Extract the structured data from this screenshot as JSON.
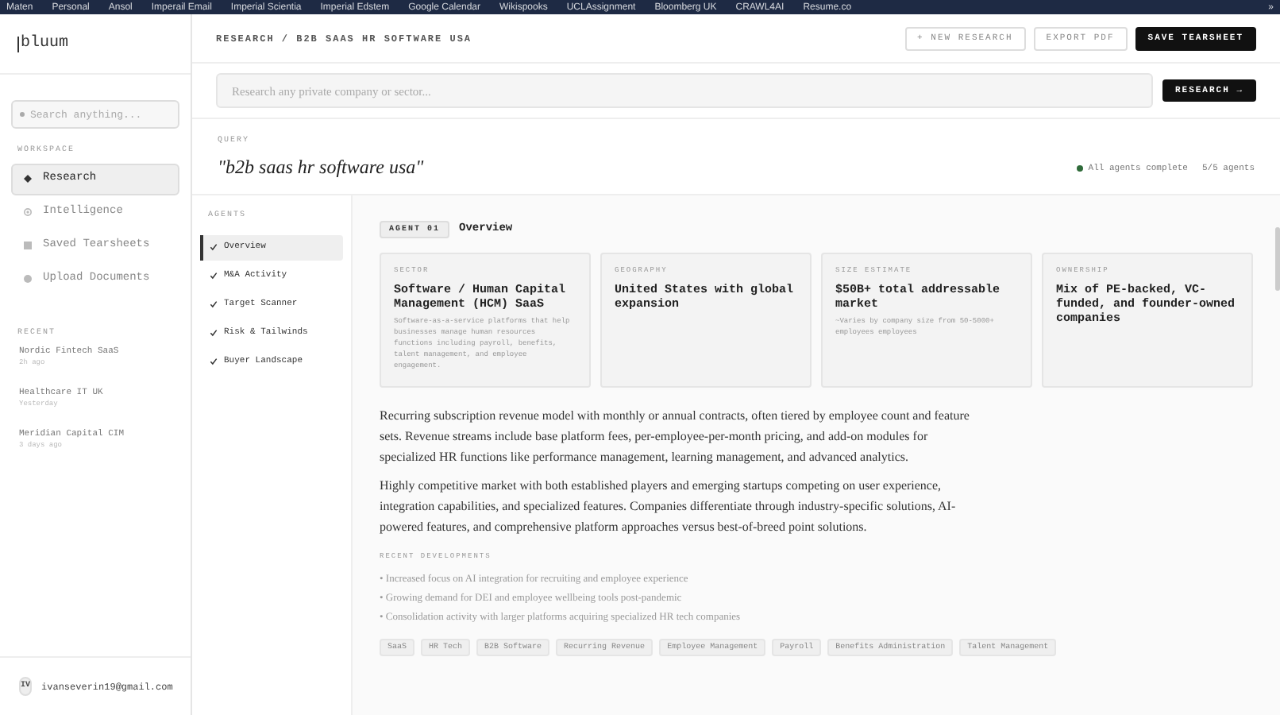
{
  "bookmarks_bar": {
    "items": [
      "Maten",
      "Personal",
      "Ansol",
      "Imperail Email",
      "Imperial Scientia",
      "Imperial Edstem",
      "Google Calendar",
      "Wikispooks",
      "UCLAssignment",
      "Bloomberg UK",
      "CRAWL4AI",
      "Resume.co"
    ],
    "overflow": "»"
  },
  "sidebar": {
    "logo": "bluum",
    "search": {
      "placeholder": "Search anything..."
    },
    "workspace_label": "WORKSPACE",
    "nav": [
      {
        "label": "Research",
        "selected": true
      },
      {
        "label": "Intelligence",
        "selected": false
      },
      {
        "label": "Saved Tearsheets",
        "selected": false
      },
      {
        "label": "Upload Documents",
        "selected": false
      }
    ],
    "recent_label": "RECENT",
    "recent": [
      {
        "title": "Nordic Fintech SaaS",
        "time": "2h ago"
      },
      {
        "title": "Healthcare IT UK",
        "time": "Yesterday"
      },
      {
        "title": "Meridian Capital CIM",
        "time": "3 days ago"
      }
    ],
    "user": {
      "initials": "IV",
      "email": "ivanseverin19@gmail.com"
    }
  },
  "header": {
    "breadcrumb": "RESEARCH / B2B SAAS HR SOFTWARE USA",
    "buttons": [
      {
        "label": "+ NEW RESEARCH",
        "kind": "outline"
      },
      {
        "label": "EXPORT PDF",
        "kind": "outline"
      },
      {
        "label": "SAVE TEARSHEET",
        "kind": "primary"
      }
    ]
  },
  "search": {
    "placeholder": "Research any private company or sector...",
    "button": "RESEARCH →"
  },
  "query": {
    "label": "QUERY",
    "text": "\"b2b saas hr software usa\"",
    "status": "All agents complete",
    "count": "5/5 agents"
  },
  "agents": {
    "label": "AGENTS",
    "items": [
      {
        "label": "Overview",
        "done": true,
        "selected": true
      },
      {
        "label": "M&A Activity",
        "done": true,
        "selected": false
      },
      {
        "label": "Target Scanner",
        "done": true,
        "selected": false
      },
      {
        "label": "Risk & Tailwinds",
        "done": true,
        "selected": false
      },
      {
        "label": "Buyer Landscape",
        "done": true,
        "selected": false
      }
    ]
  },
  "overview": {
    "badge": "AGENT 01",
    "title": "Overview",
    "cards": [
      {
        "label": "SECTOR",
        "value": "Software / Human Capital Management (HCM) SaaS",
        "note": "Software-as-a-service platforms that help businesses manage human resources functions including payroll, benefits, talent management, and employee engagement."
      },
      {
        "label": "GEOGRAPHY",
        "value": "United States with global expansion"
      },
      {
        "label": "SIZE ESTIMATE",
        "value": "$50B+ total addressable market",
        "note": "~Varies by company size from 50-5000+ employees employees"
      },
      {
        "label": "OWNERSHIP",
        "value": "Mix of PE-backed, VC-funded, and founder-owned companies"
      }
    ],
    "paragraphs": [
      "Recurring subscription revenue model with monthly or annual contracts, often tiered by employee count and feature sets. Revenue streams include base platform fees, per-employee-per-month pricing, and add-on modules for specialized HR functions like performance management, learning management, and advanced analytics.",
      "Highly competitive market with both established players and emerging startups competing on user experience, integration capabilities, and specialized features. Companies differentiate through industry-specific solutions, AI-powered features, and comprehensive platform approaches versus best-of-breed point solutions."
    ],
    "developments_label": "RECENT DEVELOPMENTS",
    "developments": [
      "• Increased focus on AI integration for recruiting and employee experience",
      "• Growing demand for DEI and employee wellbeing tools post-pandemic",
      "• Consolidation activity with larger platforms acquiring specialized HR tech companies"
    ],
    "tags": [
      "SaaS",
      "HR Tech",
      "B2B Software",
      "Recurring Revenue",
      "Employee Management",
      "Payroll",
      "Benefits Administration",
      "Talent Management"
    ]
  }
}
